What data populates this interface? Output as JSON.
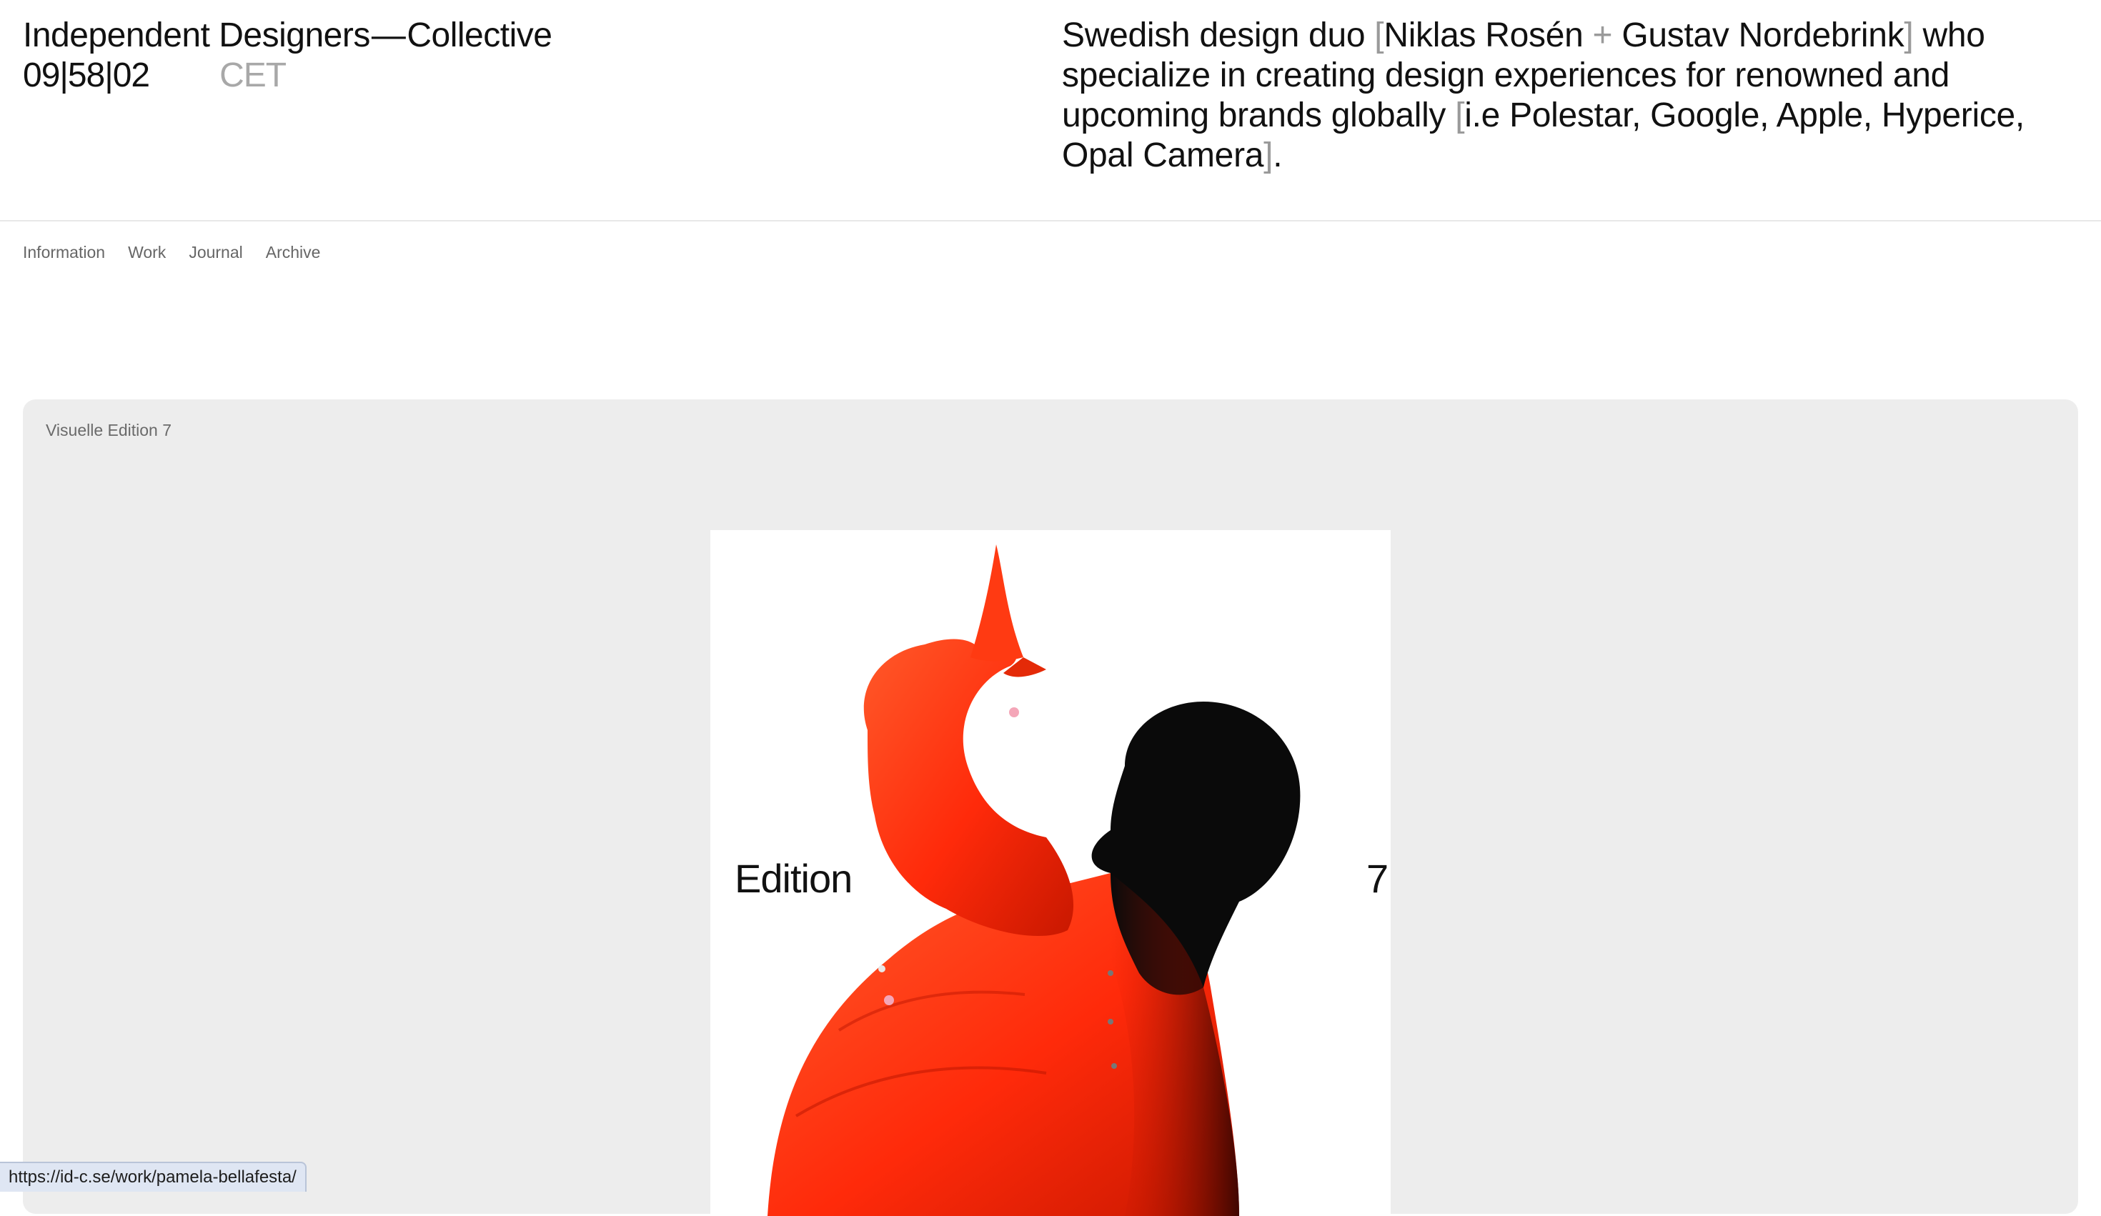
{
  "header": {
    "brand_left": "Independent Designers",
    "brand_dash": "—",
    "brand_right": "Collective",
    "clock": "09|58|02",
    "timezone": "CET",
    "intro_part1": "Swedish design duo ",
    "bracket_open": "[",
    "intro_names_1": "Niklas Rosén ",
    "plus": "+",
    "intro_names_2": " Gustav Nordebrink",
    "bracket_close": "]",
    "intro_part2": " who specialize in creating design experiences for renowned and upcoming brands globally ",
    "bracket_open2": "[",
    "intro_brands": "i.e Polestar, Google, Apple, Hyperice, Opal Camera",
    "bracket_close2": "]",
    "intro_end": "."
  },
  "nav": {
    "items": [
      {
        "label": "Information"
      },
      {
        "label": "Work"
      },
      {
        "label": "Journal"
      },
      {
        "label": "Archive"
      }
    ]
  },
  "project": {
    "label": "Visuelle Edition 7",
    "cover_word": "Edition",
    "cover_number": "7"
  },
  "status_bar": {
    "url": "https://id-c.se/work/pamela-bellafesta/"
  },
  "colors": {
    "accent_red": "#ff3a12",
    "panel_bg": "#ededed"
  }
}
